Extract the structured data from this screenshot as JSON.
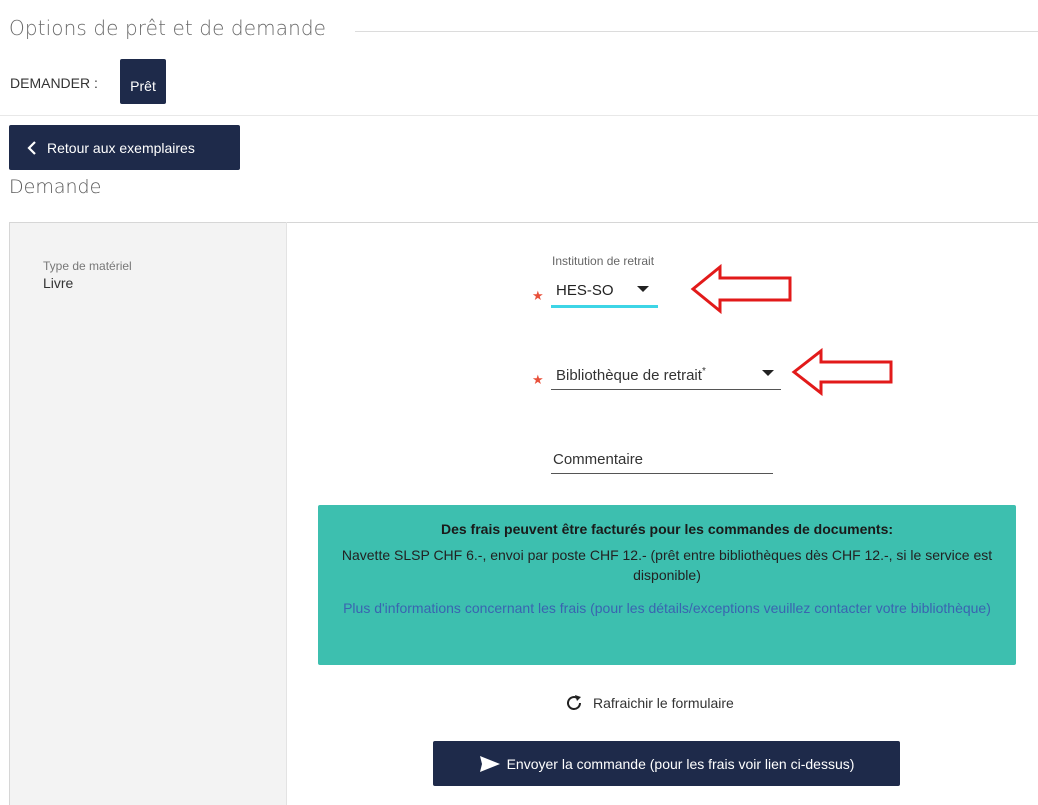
{
  "header": {
    "section_title": "Options de prêt et de demande",
    "request_label": "DEMANDER :",
    "loan_button": "Prêt",
    "back_button": "Retour aux exemplaires",
    "request_title": "Demande"
  },
  "material": {
    "label": "Type de matériel",
    "value": "Livre"
  },
  "form": {
    "institution": {
      "label": "Institution de retrait",
      "value": "HES-SO",
      "required_marker": "★"
    },
    "library": {
      "placeholder": "Bibliothèque de retrait",
      "asterisk": "*",
      "required_marker": "★"
    },
    "comment": {
      "placeholder": "Commentaire"
    }
  },
  "info_box": {
    "title": "Des frais peuvent être facturés pour les commandes de documents:",
    "text": "Navette SLSP CHF 6.-, envoi par poste CHF 12.- (prêt entre bibliothèques dès CHF 12.-, si le service est disponible)",
    "link": "Plus d'informations concernant les frais (pour les détails/exceptions veuillez contacter votre bibliothèque)"
  },
  "actions": {
    "refresh": "Rafraichir le formulaire",
    "send": "Envoyer la commande (pour les frais voir lien ci-dessus)"
  },
  "colors": {
    "primary_button": "#1e2a4a",
    "info_background": "#3dbfaf",
    "focus_underline": "#3dd5e6",
    "required_star": "#e8503a",
    "annotation_arrow": "#e21a1a"
  },
  "icons": {
    "back": "chevron-left-icon",
    "dropdown": "caret-down-icon",
    "refresh": "refresh-icon",
    "send": "send-icon",
    "annotation": "red-arrow-icon"
  }
}
